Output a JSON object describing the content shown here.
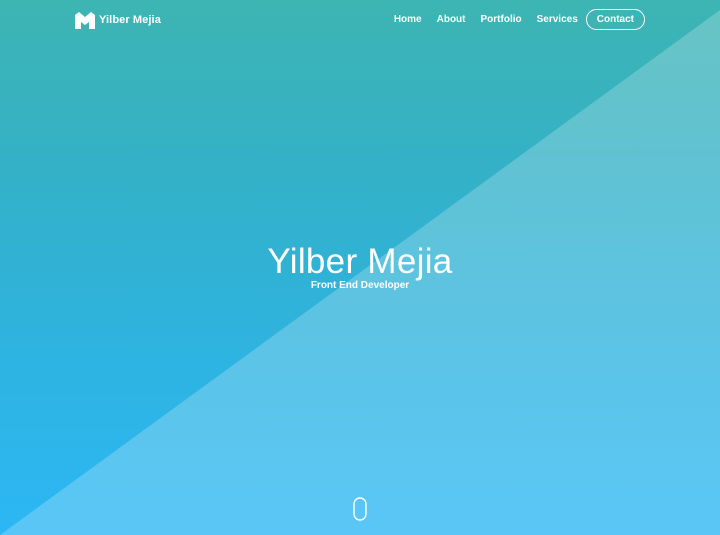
{
  "brand": {
    "name": "Yilber Mejia",
    "logo_icon": "m-logo-icon"
  },
  "nav": {
    "links": [
      "Home",
      "About",
      "Portfolio",
      "Services"
    ],
    "contact_label": "Contact"
  },
  "hero": {
    "title": "Yilber Mejia",
    "subtitle": "Front End Developer",
    "scroll_icon": "mouse-scroll-icon"
  },
  "colors": {
    "gradient_top": "#3db5b3",
    "gradient_bottom": "#2cb7f5",
    "overlay": "#ffffff",
    "text": "#ffffff"
  }
}
